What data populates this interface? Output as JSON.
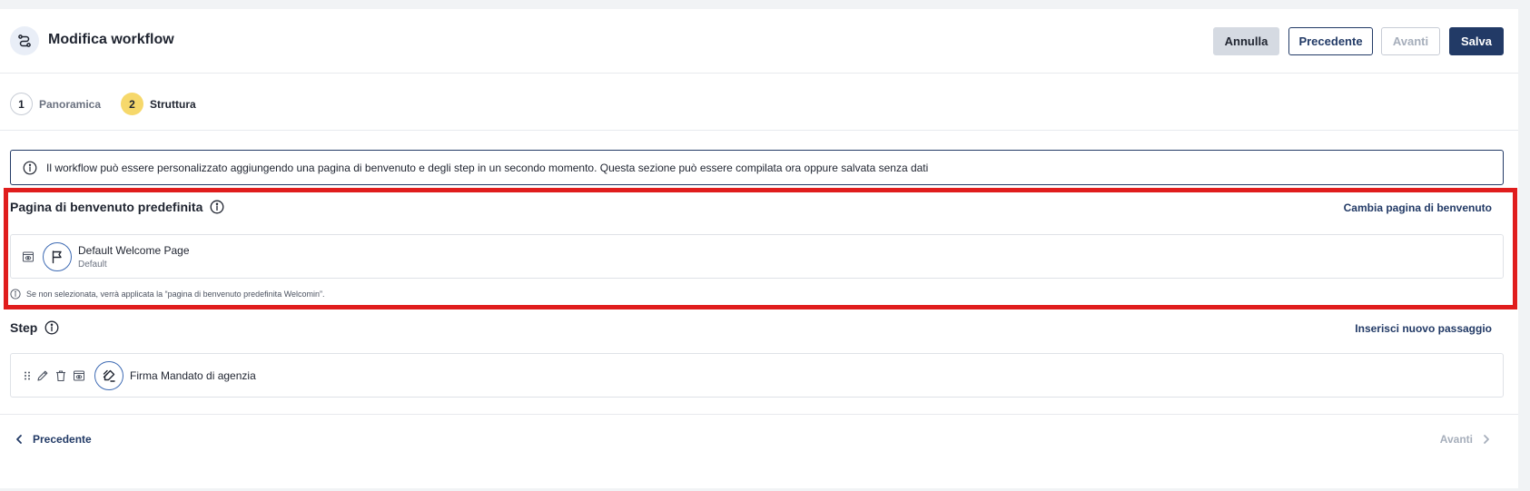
{
  "header": {
    "title": "Modifica workflow",
    "buttons": {
      "cancel": "Annulla",
      "previous": "Precedente",
      "next": "Avanti",
      "save": "Salva"
    }
  },
  "stepper": {
    "steps": [
      {
        "number": "1",
        "label": "Panoramica",
        "active": false
      },
      {
        "number": "2",
        "label": "Struttura",
        "active": true
      }
    ]
  },
  "info_banner": {
    "text": "Il workflow può essere personalizzato aggiungendo una pagina di benvenuto e degli step in un secondo momento. Questa sezione può essere compilata ora oppure salvata senza dati"
  },
  "welcome_section": {
    "title": "Pagina di benvenuto predefinita",
    "action_label": "Cambia pagina di benvenuto",
    "item": {
      "name": "Default Welcome Page",
      "subtitle": "Default"
    },
    "note": "Se non selezionata, verrà applicata la “pagina di benvenuto predefinita Welcomin”."
  },
  "steps_section": {
    "title": "Step",
    "action_label": "Inserisci nuovo passaggio",
    "items": [
      {
        "name": "Firma Mandato di agenzia"
      }
    ]
  },
  "footer": {
    "previous": "Precedente",
    "next": "Avanti"
  },
  "colors": {
    "primary": "#223a66",
    "highlight": "#e01d1d",
    "active_step": "#f6d86b",
    "disabled": "#a6aebb"
  }
}
